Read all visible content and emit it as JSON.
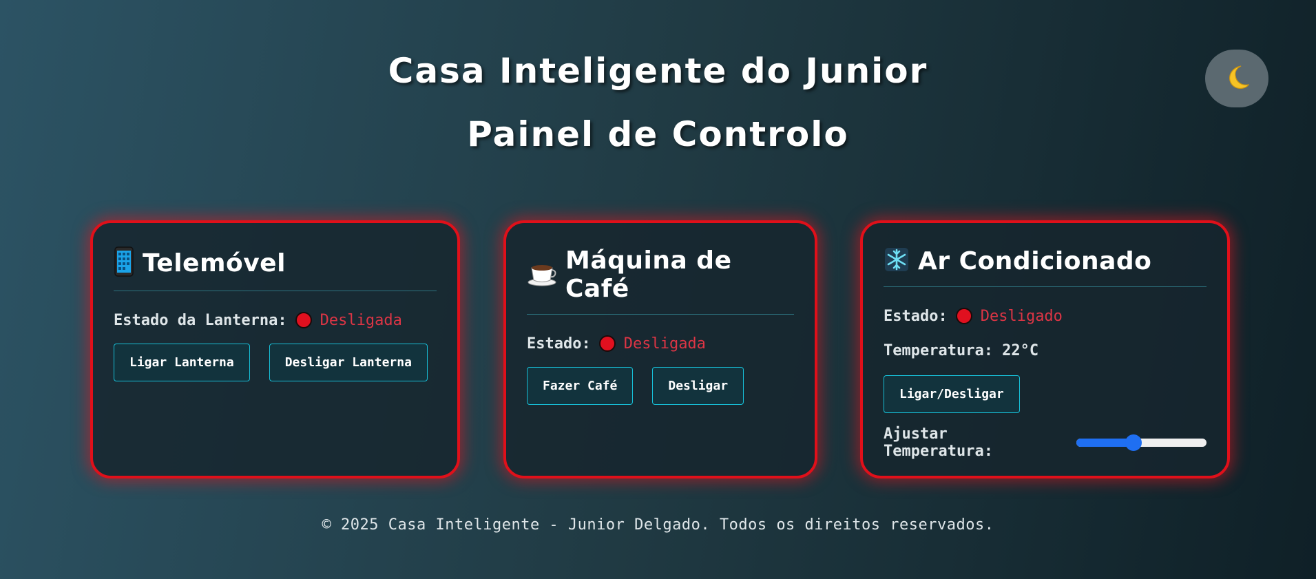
{
  "header": {
    "title_line1": "Casa Inteligente do Junior",
    "title_line2": "Painel de Controlo",
    "theme_toggle_icon": "moon-icon"
  },
  "colors": {
    "card_border": "#e0101a",
    "status_off": "#dc3545",
    "button_border": "#17c0d8",
    "slider_accent": "#1f6ff2"
  },
  "cards": {
    "phone": {
      "icon": "mobile-phone-icon",
      "title": "Telemóvel",
      "status_label": "Estado da Lanterna:",
      "status_value": "Desligada",
      "buttons": [
        "Ligar Lanterna",
        "Desligar Lanterna"
      ]
    },
    "coffee": {
      "icon": "coffee-cup-icon",
      "title": "Máquina de Café",
      "status_label": "Estado:",
      "status_value": "Desligada",
      "buttons": [
        "Fazer Café",
        "Desligar"
      ]
    },
    "ac": {
      "icon": "snowflake-icon",
      "title": "Ar Condicionado",
      "status_label": "Estado:",
      "status_value": "Desligado",
      "temperature_text": "Temperatura: 22°C",
      "toggle_button": "Ligar/Desligar",
      "slider_label": "Ajustar Temperatura:",
      "slider_level": 0.44
    }
  },
  "footer": {
    "text": "© 2025 Casa Inteligente - Junior Delgado. Todos os direitos reservados."
  }
}
